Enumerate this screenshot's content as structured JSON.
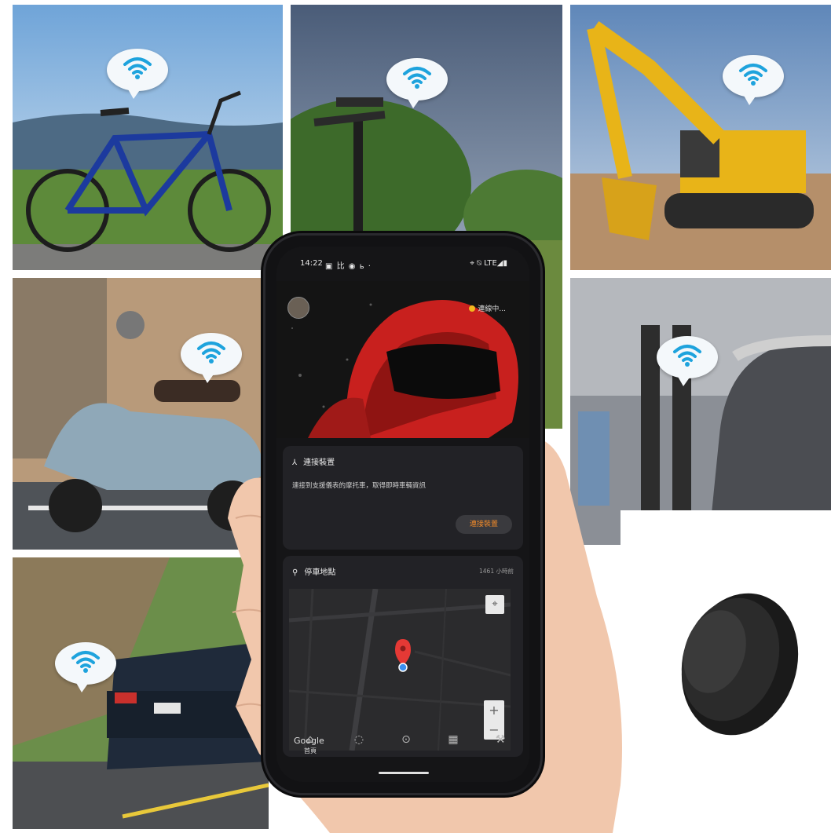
{
  "status_bar": {
    "time": "14:22",
    "left_icons": "▣ 比 ◉ ь ·",
    "right_icons": "⌖ ⍉ LTE◢▮"
  },
  "header": {
    "connection_status": "連線中..."
  },
  "connect_card": {
    "title": "連接裝置",
    "description": "連接到支援儀表的摩托車，取得即時車輛資訊",
    "button_label": "連接裝置"
  },
  "parking_card": {
    "title": "停車地點",
    "eta": "1461 小時前",
    "map_branding": "Google",
    "zoom_in": "+",
    "zoom_out": "−"
  },
  "bottom_nav": {
    "items": [
      {
        "label": "首頁",
        "icon": "home-icon"
      },
      {
        "label": "",
        "icon": "circle-icon"
      },
      {
        "label": "",
        "icon": "speed-icon"
      },
      {
        "label": "",
        "icon": "grid-icon"
      },
      {
        "label": "",
        "icon": "tool-icon"
      }
    ]
  },
  "colors": {
    "accent_orange": "#f08a2a",
    "status_yellow": "#f2b81e",
    "pin_red": "#e53935",
    "wifi_blue": "#1ea3dd"
  }
}
